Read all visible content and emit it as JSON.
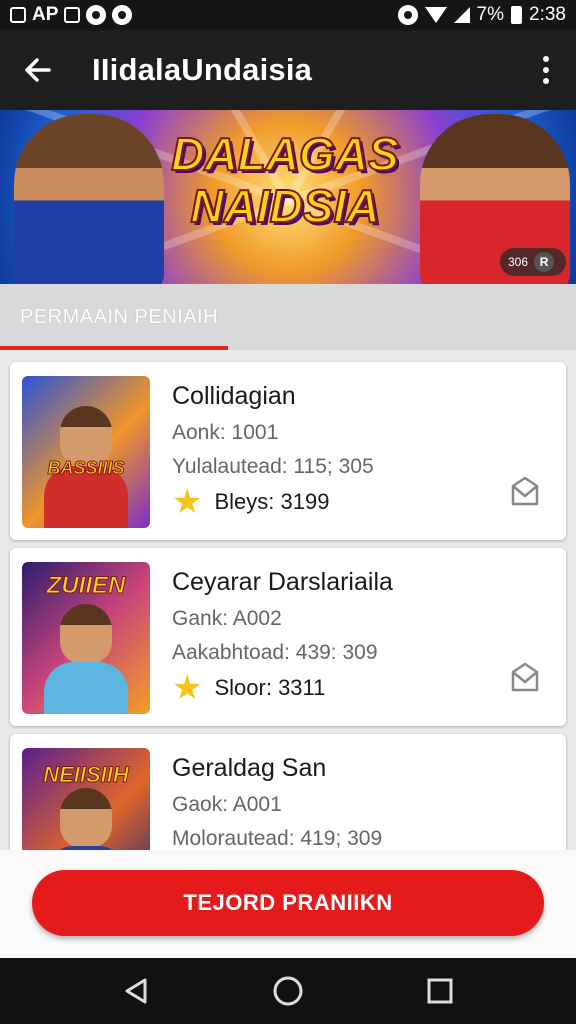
{
  "status_bar": {
    "left_text": "AP",
    "battery": "7%",
    "time": "2:38"
  },
  "app_bar": {
    "title": "IIidalaUndaisia"
  },
  "banner": {
    "logo_line1": "DALAGAS",
    "logo_line2": "NAIDSIA",
    "badge_text": "306"
  },
  "section": {
    "title": "PERMAAIN PENIAIH"
  },
  "games": [
    {
      "name": "Collidagian",
      "code": "Aonk: 1001",
      "stat": "Yulalautead: 115; 305",
      "rating": "Bleys: 3199",
      "thumb_word": "BASSIIIS"
    },
    {
      "name": "Ceyarar Darslariaila",
      "code": "Gank: A002",
      "stat": "Aakabhtoad: 439: 309",
      "rating": "Sloor: 3311",
      "thumb_word": "ZUIIEN"
    },
    {
      "name": "Geraldag San",
      "code": "Gaok: A001",
      "stat": "Molorautead: 419; 309",
      "rating": "",
      "thumb_word": "NEIISIIH"
    }
  ],
  "cta": {
    "label": "TEJORD PRANIIKN"
  },
  "colors": {
    "accent": "#e51b1b",
    "star": "#f7c21a",
    "appbar": "#1e1e1e"
  }
}
